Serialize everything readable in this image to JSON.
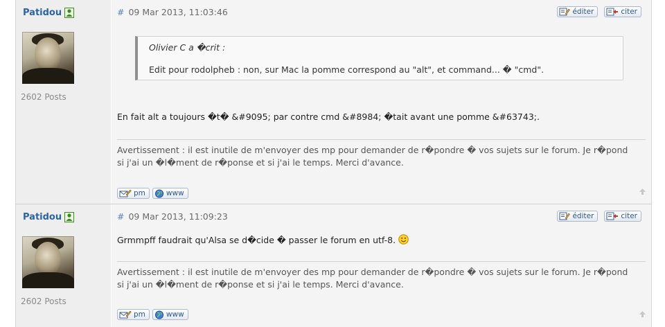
{
  "posts": [
    {
      "author": "Patidou",
      "posts_count": "2602 Posts",
      "hash": "#",
      "date": "09 Mar 2013, 11:03:46",
      "edit_label": "éditer",
      "quote_label": "citer",
      "quote": {
        "author": "Olivier C a �crit :",
        "text": "Edit pour rodolpheb : non, sur Mac la pomme correspond au \"alt\", et command... � \"cmd\"."
      },
      "message": "En fait alt a toujours �t� &#9095; par contre cmd &#8984; �tait avant une pomme &#63743;.",
      "signature_line1": "Avertissement : il est inutile de m'envoyer des mp pour demander de r�pondre � vos sujets sur le forum. Je r�pond",
      "signature_line2": "si j'ai un �l�ment de r�ponse et si j'ai le temps. Merci d'avance.",
      "pm_label": "pm",
      "www_label": "www"
    },
    {
      "author": "Patidou",
      "posts_count": "2602 Posts",
      "hash": "#",
      "date": "09 Mar 2013, 11:09:23",
      "edit_label": "éditer",
      "quote_label": "citer",
      "message": "Grmmpff faudrait qu'Alsa se d�cide � passer le forum en utf-8.",
      "signature_line1": "Avertissement : il est inutile de m'envoyer des mp pour demander de r�pondre � vos sujets sur le forum. Je r�pond",
      "signature_line2": "si j'ai un �l�ment de r�ponse et si j'ai le temps. Merci d'avance.",
      "pm_label": "pm",
      "www_label": "www"
    }
  ]
}
